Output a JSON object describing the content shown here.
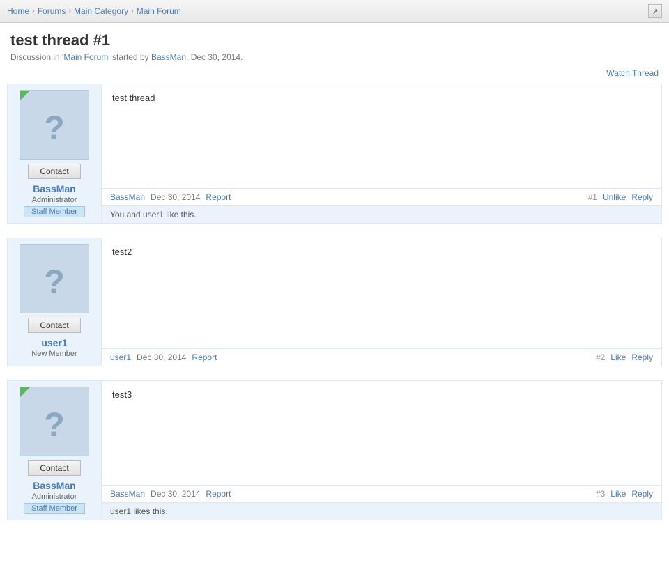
{
  "breadcrumb": {
    "items": [
      "Home",
      "Forums",
      "Main Category",
      "Main Forum"
    ],
    "external_icon": "↗"
  },
  "page": {
    "title": "test thread #1",
    "subtitle_prefix": "Discussion in '",
    "subtitle_forum": "Main Forum",
    "subtitle_suffix": "' started by ",
    "subtitle_user": "BassMan",
    "subtitle_date": ", Dec 30, 2014.",
    "watch_btn": "Watch Thread"
  },
  "posts": [
    {
      "id": 1,
      "number": "#1",
      "body": "test thread",
      "author": "BassMan",
      "date": "Dec 30, 2014",
      "report": "Report",
      "actions": [
        "Unlike",
        "Reply"
      ],
      "has_online": true,
      "role": "Administrator",
      "staff": "Staff Member",
      "likes_text": "You and user1 like this."
    },
    {
      "id": 2,
      "number": "#2",
      "body": "test2",
      "author": "user1",
      "date": "Dec 30, 2014",
      "report": "Report",
      "actions": [
        "Like",
        "Reply"
      ],
      "has_online": false,
      "role": "New Member",
      "staff": null,
      "likes_text": null
    },
    {
      "id": 3,
      "number": "#3",
      "body": "test3",
      "author": "BassMan",
      "date": "Dec 30, 2014",
      "report": "Report",
      "actions": [
        "Like",
        "Reply"
      ],
      "has_online": true,
      "role": "Administrator",
      "staff": "Staff Member",
      "likes_text": "user1 likes this."
    }
  ]
}
